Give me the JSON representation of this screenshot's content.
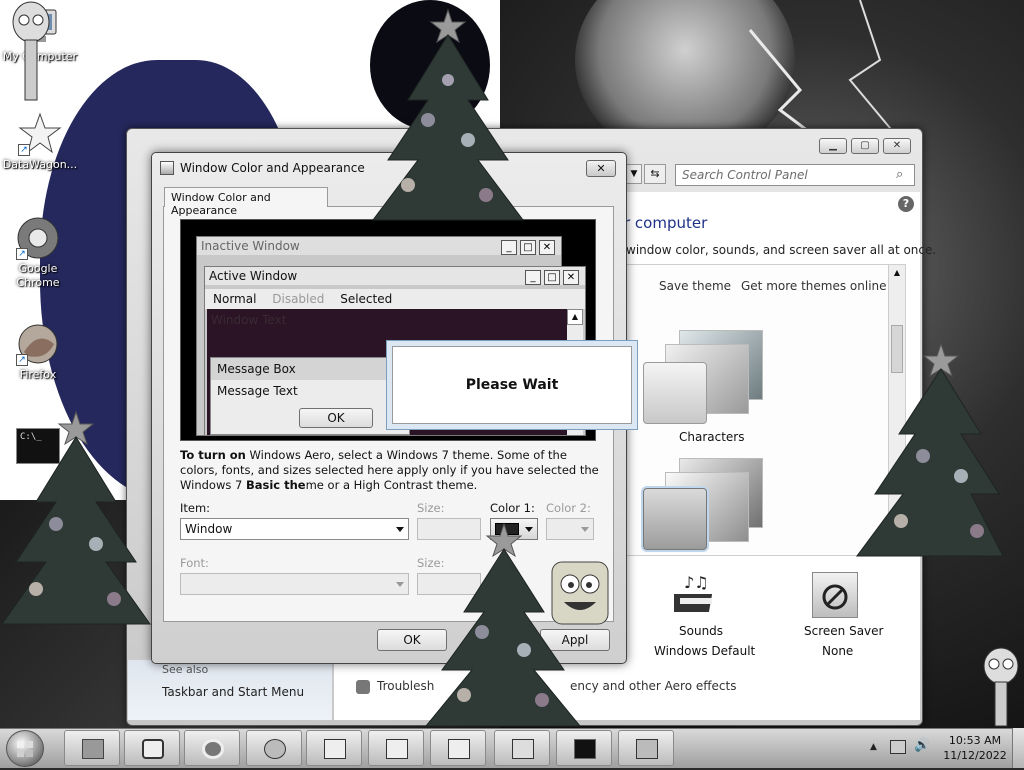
{
  "desktop": {
    "icons": [
      {
        "label": "My Computer"
      },
      {
        "label": "DataWagon..."
      },
      {
        "label": "Google Chrome"
      },
      {
        "label": "Firefox"
      }
    ]
  },
  "control_panel": {
    "search_placeholder": "Search Control Panel",
    "heading_fragment": "r computer",
    "description": "window color, sounds, and screen saver all at once.",
    "save_theme": "Save theme",
    "get_more_themes": "Get more themes online",
    "theme_label": "Characters",
    "sounds_label": "Sounds",
    "sounds_value": "Windows Default",
    "screensaver_label": "Screen Saver",
    "screensaver_value": "None",
    "see_also": "See also",
    "taskbar_link": "Taskbar and Start Menu",
    "troubleshoot_fragment": "Troublesh",
    "aero_fragment": "ency and other Aero effects"
  },
  "dialog": {
    "title": "Window Color and Appearance",
    "tab": "Window Color and Appearance",
    "preview": {
      "inactive_title": "Inactive Window",
      "active_title": "Active Window",
      "menu_normal": "Normal",
      "menu_disabled": "Disabled",
      "menu_selected": "Selected",
      "window_text": "Window Text",
      "message_box_title": "Message Box",
      "message_text": "Message Text",
      "ok": "OK"
    },
    "info_bold1": "To turn on",
    "info_text1": " Windows Aero, select a Windows 7 theme.  Some of the colors, fonts, and sizes selected here apply only if you have selected the Windows 7 ",
    "info_bold2": "Basic the",
    "info_text2": "me or a High Contrast theme.",
    "item_label": "Item:",
    "item_value": "Window",
    "size_label": "Size:",
    "color1_label": "Color 1:",
    "color2_label": "Color 2:",
    "font_label": "Font:",
    "font_size_label": "Size:",
    "ok_button": "OK",
    "apply_fragment": "Appl"
  },
  "please_wait": "Please Wait",
  "taskbar": {
    "time": "10:53 AM",
    "date": "11/12/2022"
  },
  "colors": {
    "window_text_bg": "#2a1426",
    "selection_blue": "#cfe3f6"
  }
}
